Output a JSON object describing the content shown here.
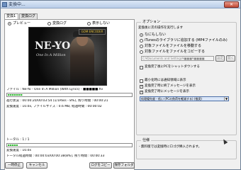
{
  "window": {
    "title": "変換中..."
  },
  "tabs": [
    {
      "label": "変換1"
    },
    {
      "label": "変換ログ"
    }
  ],
  "preview": {
    "options": [
      "プレビュー",
      "変換ログ",
      "表示しない"
    ],
    "selected": 0,
    "artist_art_text": "NE-YO",
    "album_art_text": "One In A Million",
    "badge_text": "GOM ENCODER"
  },
  "current": {
    "file_label": "ファイル : Ne-Yo - One In A Million (With Lyrics) - ■■■■■.flv",
    "progress": 0.12,
    "elapsed_line": "進行状況 : 00:00:20/00:03:54 (1/1Pass - 8%), 残り時間 : 00:00:21",
    "speed_line": "変換速度 : 10.0x, ファイルサイズ : 0.6 MB, 経過時間 : 00:00:02"
  },
  "total": {
    "label": "トータル : 1 / 1",
    "progress": 0.08,
    "speed_line": "変換速度 : 10.0x",
    "time_line": "トータル経過時間 : 00:00:03/00:00:38(8%), 残り時間 : 00:00:33"
  },
  "buttons": {
    "pause": "一時停止",
    "cancel": "キャンセル",
    "log": "ログをコピー",
    "save_folder": "保存フォルダ"
  },
  "options_group": {
    "title": "オプション",
    "after_label": "変換後に次の操作を実行します",
    "radios": [
      "なにもしない",
      "iTunesのライブラリに追加する (MP4ファイルのみ)",
      "対象ファイルをファイルを移動する",
      "対象ファイルをファイルをコピーする"
    ],
    "selected": 0,
    "path_value": "C:¥Documents and Settings¥■■■¥■■■■",
    "browse_label": "設定",
    "open_label": "開く",
    "shutdown": "変換完了後にPCをシャットダウンする",
    "checks": [
      {
        "label": "最小化時には通知領域に表示",
        "checked": false
      },
      {
        "label": "変換完了時に終了メッセージを表示",
        "checked": true
      },
      {
        "label": "変換完了時にメッセージを表示",
        "checked": true
      }
    ],
    "priority_value": "処理優先度 - 低い (PCの負荷を軽減する) (推奨)"
  },
  "notes_group": {
    "title": "仕様",
    "text": "- 無料版では変換時にロゴが挿入されます。"
  }
}
